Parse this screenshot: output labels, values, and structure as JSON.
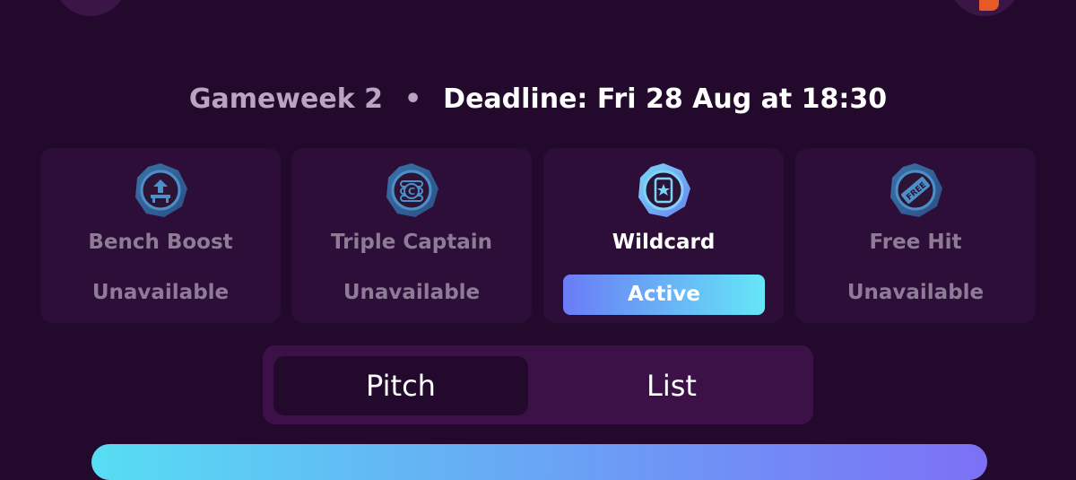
{
  "header": {
    "gameweek": "Gameweek 2",
    "separator": "•",
    "deadline": "Deadline: Fri 28 Aug at 18:30"
  },
  "chips": [
    {
      "name": "Bench Boost",
      "status": "Unavailable",
      "icon": "bench-boost-icon"
    },
    {
      "name": "Triple Captain",
      "status": "Unavailable",
      "icon": "triple-captain-icon"
    },
    {
      "name": "Wildcard",
      "status": "Active",
      "icon": "wildcard-icon"
    },
    {
      "name": "Free Hit",
      "status": "Unavailable",
      "icon": "free-hit-icon"
    }
  ],
  "view_toggle": {
    "options": [
      "Pitch",
      "List"
    ],
    "selected": "Pitch"
  },
  "colors": {
    "background": "#230a2d",
    "card": "#2d0e38",
    "muted_text": "#8e7b96",
    "accent_gradient_start": "#6a7cf6",
    "accent_gradient_end": "#66e6f7"
  }
}
